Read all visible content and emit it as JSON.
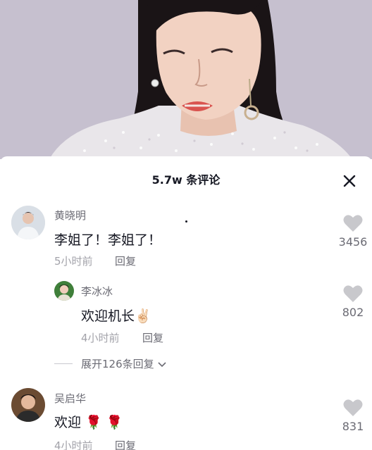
{
  "header": {
    "title": "5.7w 条评论",
    "close_icon": "close-icon"
  },
  "comments": [
    {
      "username": "黄晓明",
      "text": "李姐了！李姐了！",
      "time": "5小时前",
      "reply_label": "回复",
      "likes": "3456",
      "replies": [
        {
          "username": "李冰冰",
          "text": "欢迎机长",
          "emoji": "✌🏻",
          "time": "4小时前",
          "reply_label": "回复",
          "likes": "802"
        }
      ],
      "expand_label": "展开126条回复"
    },
    {
      "username": "吴启华",
      "text": "欢迎",
      "emoji": "🌹 🌹",
      "time": "4小时前",
      "reply_label": "回复",
      "likes": "831"
    }
  ],
  "colors": {
    "text_primary": "#161823",
    "text_secondary": "#6b6b74",
    "text_muted": "#a3a3aa",
    "heart": "#c8c8cc"
  }
}
